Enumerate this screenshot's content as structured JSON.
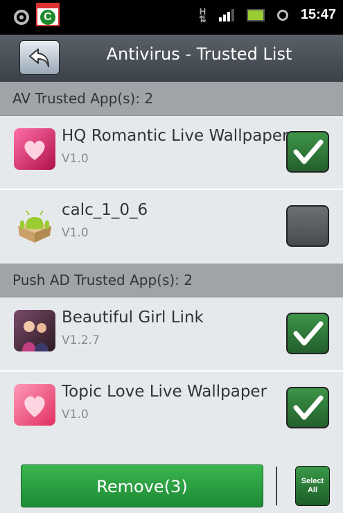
{
  "status_bar": {
    "time": "15:47",
    "network_label": "H"
  },
  "header": {
    "title": "Antivirus - Trusted List"
  },
  "av_section": {
    "label": "AV Trusted App(s): 2",
    "items": [
      {
        "name": "HQ Romantic Live Wallpaper",
        "version": "V1.0",
        "checked": true
      },
      {
        "name": "calc_1_0_6",
        "version": "V1.0",
        "checked": false
      }
    ]
  },
  "push_section": {
    "label": "Push AD Trusted App(s): 2",
    "items": [
      {
        "name": "Beautiful Girl Link",
        "version": "V1.2.7",
        "checked": true
      },
      {
        "name": "Topic Love Live Wallpaper",
        "version": "V1.0",
        "checked": true
      }
    ]
  },
  "actions": {
    "remove_label": "Remove(3)",
    "select_all_label": "Select All"
  },
  "colors": {
    "accent_green": "#2a9a3e",
    "header_bg": "#4a5058",
    "section_bg": "#a0a4a8"
  }
}
